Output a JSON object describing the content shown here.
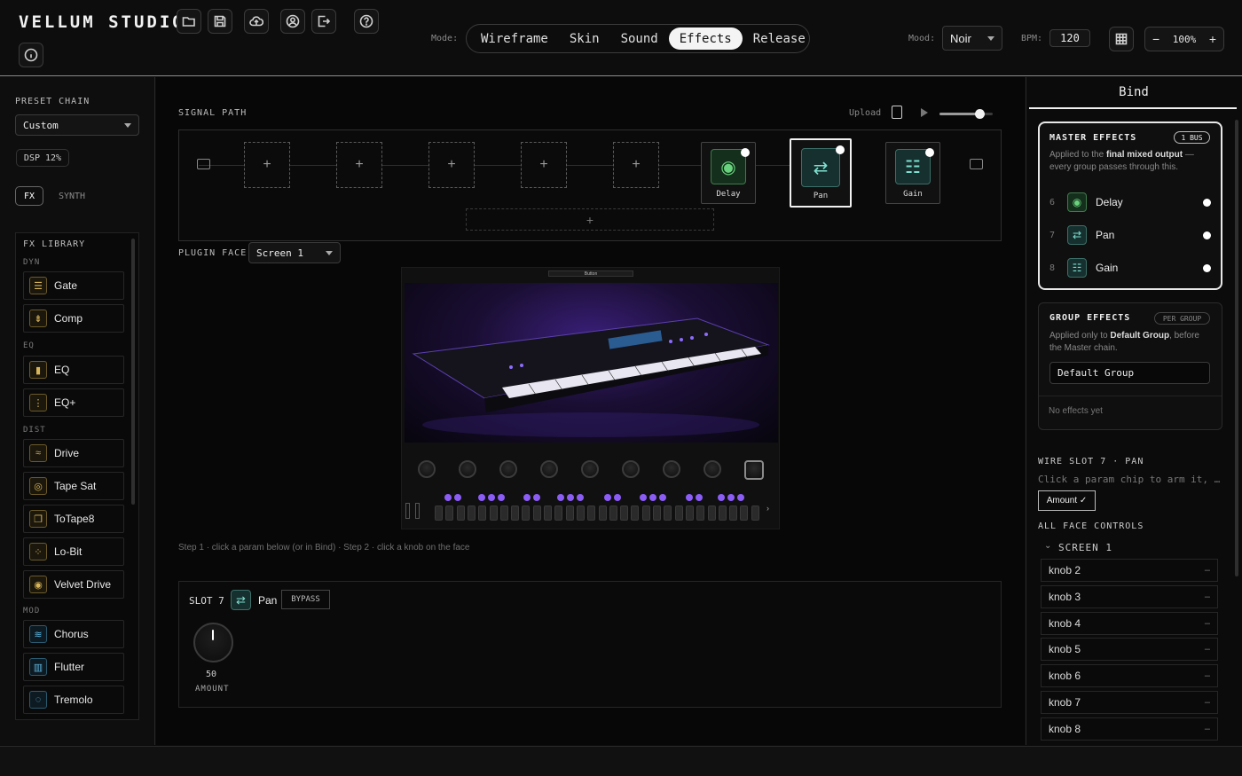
{
  "app": {
    "title": "VELLUM STUDIO"
  },
  "toolbar": {
    "icons": [
      "folder-open-icon",
      "save-icon",
      "cloud-upload-icon",
      "account-icon",
      "logout-icon",
      "help-icon",
      "info-icon"
    ]
  },
  "mode": {
    "label": "Mode:",
    "tabs": [
      "Wireframe",
      "Skin",
      "Sound",
      "Effects",
      "Release"
    ],
    "active": "Effects"
  },
  "mood": {
    "label": "Mood:",
    "value": "Noir"
  },
  "bpm": {
    "label": "BPM:",
    "value": "120"
  },
  "zoom": {
    "minus": "−",
    "value": "100%",
    "plus": "+"
  },
  "left": {
    "preset_title": "PRESET CHAIN",
    "preset_value": "Custom",
    "dsp": "DSP 12%",
    "tab_fx": "FX",
    "tab_synth": "SYNTH",
    "library_title": "FX LIBRARY",
    "cats": {
      "dyn": "DYN",
      "eq": "EQ",
      "dist": "DIST",
      "mod": "MOD"
    },
    "items": [
      "Gate",
      "Comp",
      "EQ",
      "EQ+",
      "Drive",
      "Tape Sat",
      "ToTape8",
      "Lo-Bit",
      "Velvet Drive",
      "Chorus",
      "Flutter",
      "Tremolo"
    ]
  },
  "signal": {
    "title": "SIGNAL PATH",
    "upload": "Upload",
    "empty_slot": "+",
    "add": "+",
    "effects": [
      "Delay",
      "Pan",
      "Gain"
    ],
    "preview_level": 0.75
  },
  "plugin": {
    "label": "PLUGIN FACE",
    "screen": "Screen 1",
    "preview_title": "Button",
    "hint": "Step 1 · click a param below (or in Bind) · Step 2 · click a knob on the face"
  },
  "slot": {
    "label": "SLOT 7",
    "name": "Pan",
    "bypass": "BYPASS",
    "amount_value": "50",
    "amount_label": "AMOUNT"
  },
  "bind": {
    "header": "Bind",
    "master_title": "MASTER EFFECTS",
    "master_badge": "1 BUS",
    "master_desc_a": "Applied to the ",
    "master_desc_b": "final mixed output",
    "master_desc_c": " — every group passes through this.",
    "master_fx": [
      {
        "n": "6",
        "name": "Delay"
      },
      {
        "n": "7",
        "name": "Pan"
      },
      {
        "n": "8",
        "name": "Gain"
      }
    ],
    "group_title": "GROUP EFFECTS",
    "group_badge": "PER GROUP",
    "group_desc_a": "Applied only to ",
    "group_desc_b": "Default Group",
    "group_desc_c": ", before the Master chain.",
    "group_value": "Default Group",
    "group_empty": "No effects yet",
    "wire_title": "WIRE SLOT 7 · PAN",
    "wire_hint": "Click a param chip to arm it, …",
    "wire_chip": "Amount ✓",
    "all_title": "ALL FACE CONTROLS",
    "screen_group": "SCREEN 1",
    "controls": [
      "knob 2",
      "knob 3",
      "knob 4",
      "knob 5",
      "knob 6",
      "knob 7",
      "knob 8"
    ],
    "control_dash": "–"
  },
  "colors": {
    "accent": "#7ee0d0",
    "lib_icon": "#d7b458",
    "preview_glow": "#7a4dff"
  }
}
